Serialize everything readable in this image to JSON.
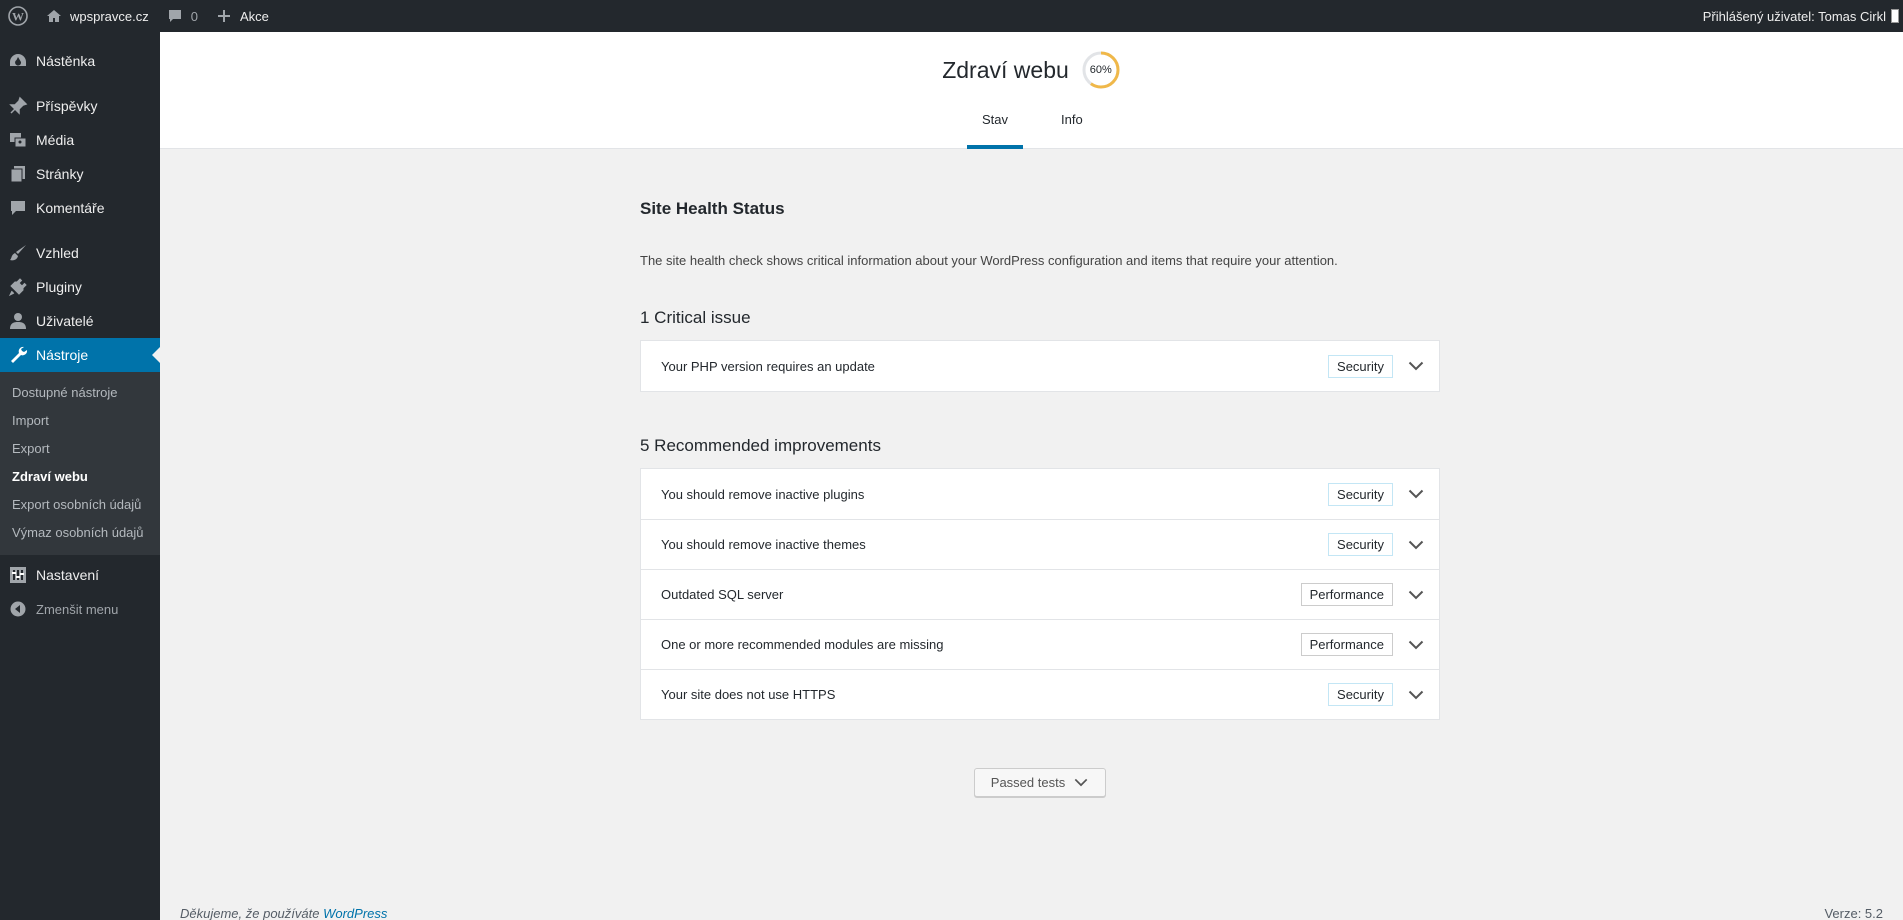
{
  "adminbar": {
    "site_name": "wpspravce.cz",
    "comments_count": "0",
    "new_label": "Akce",
    "user_greeting": "Přihlášený uživatel: Tomas Cirkl"
  },
  "sidebar": {
    "items": [
      {
        "label": "Nástěnka",
        "icon": "dashboard-icon"
      },
      {
        "label": "Příspěvky",
        "icon": "pin-icon"
      },
      {
        "label": "Média",
        "icon": "media-icon"
      },
      {
        "label": "Stránky",
        "icon": "pages-icon"
      },
      {
        "label": "Komentáře",
        "icon": "comment-icon"
      },
      {
        "label": "Vzhled",
        "icon": "brush-icon"
      },
      {
        "label": "Pluginy",
        "icon": "plugin-icon"
      },
      {
        "label": "Uživatelé",
        "icon": "user-icon"
      },
      {
        "label": "Nástroje",
        "icon": "wrench-icon"
      }
    ],
    "submenu": [
      "Dostupné nástroje",
      "Import",
      "Export",
      "Zdraví webu",
      "Export osobních údajů",
      "Výmaz osobních údajů"
    ],
    "settings_label": "Nastavení",
    "collapse_label": "Zmenšit menu"
  },
  "header": {
    "title": "Zdraví webu",
    "score": "60%",
    "score_value": 60,
    "tabs": [
      "Stav",
      "Info"
    ]
  },
  "main": {
    "status_title": "Site Health Status",
    "description": "The site health check shows critical information about your WordPress configuration and items that require your attention.",
    "critical_title": "1 Critical issue",
    "critical_issues": [
      {
        "label": "Your PHP version requires an update",
        "badge": "Security"
      }
    ],
    "recommended_title": "5 Recommended improvements",
    "recommended": [
      {
        "label": "You should remove inactive plugins",
        "badge": "Security"
      },
      {
        "label": "You should remove inactive themes",
        "badge": "Security"
      },
      {
        "label": "Outdated SQL server",
        "badge": "Performance"
      },
      {
        "label": "One or more recommended modules are missing",
        "badge": "Performance"
      },
      {
        "label": "Your site does not use HTTPS",
        "badge": "Security"
      }
    ],
    "passed_label": "Passed tests"
  },
  "footer": {
    "thanks": "Děkujeme, že používáte",
    "link": "WordPress",
    "version": "Verze: 5.2"
  },
  "colors": {
    "accent": "#0073aa",
    "sidebar_bg": "#23282d",
    "progress": "#f0b849"
  }
}
